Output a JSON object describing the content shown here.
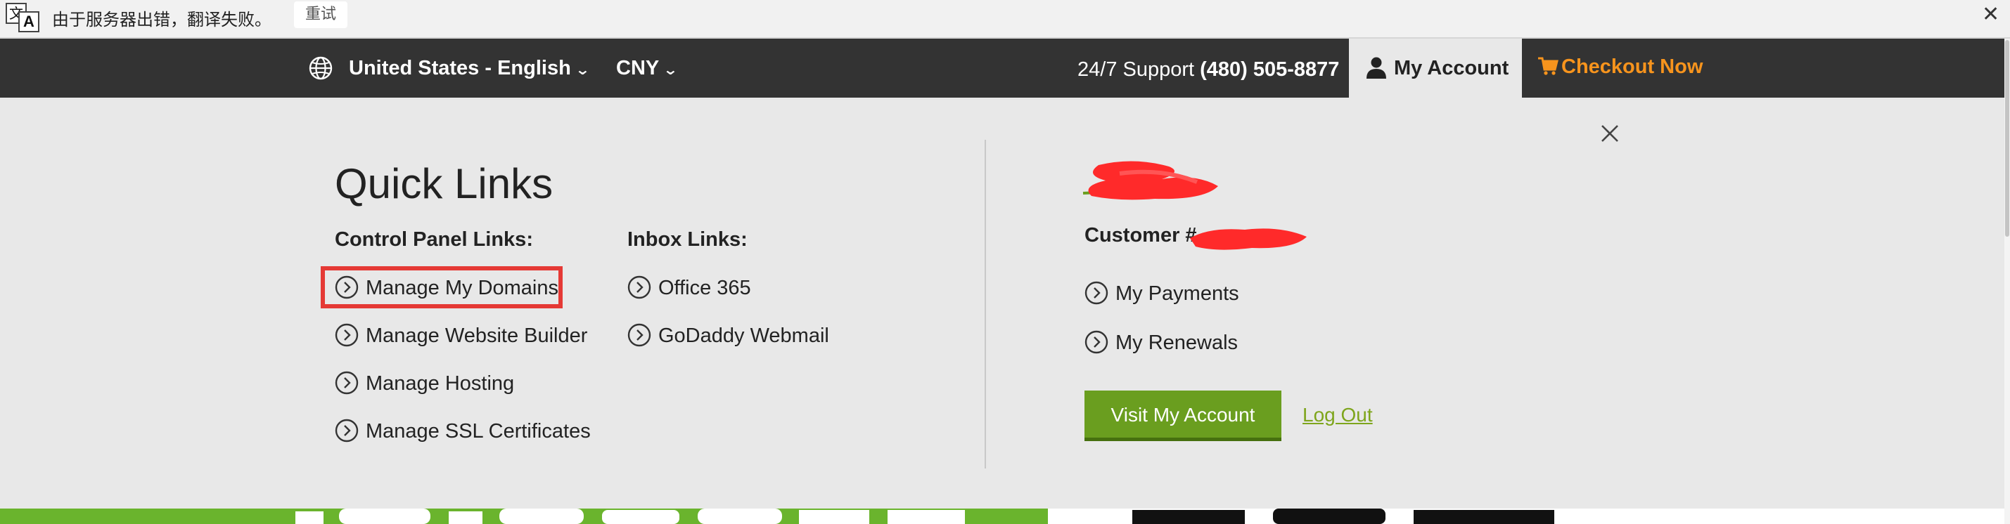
{
  "translate_bar": {
    "message": "由于服务器出错，翻译失败。",
    "retry_label": "重试",
    "close_glyph": "✕",
    "icon": "translate-icon"
  },
  "topnav": {
    "language": "United States - English",
    "currency": "CNY",
    "support_label": "24/7 Support",
    "support_phone": "(480) 505-8877",
    "account_label": "My Account",
    "checkout_label": "Checkout Now",
    "colors": {
      "bar": "#333333",
      "checkout": "#f7941d",
      "account_tab": "#e8e8e8"
    }
  },
  "panel": {
    "title": "Quick Links",
    "control_heading": "Control Panel Links:",
    "control_links": [
      {
        "label": "Manage My Domains"
      },
      {
        "label": "Manage Website Builder"
      },
      {
        "label": "Manage Hosting"
      },
      {
        "label": "Manage SSL Certificates"
      }
    ],
    "inbox_heading": "Inbox Links:",
    "inbox_links": [
      {
        "label": "Office 365"
      },
      {
        "label": "GoDaddy Webmail"
      }
    ],
    "customer_label": "Customer #",
    "account_links": [
      {
        "label": "My Payments"
      },
      {
        "label": "My Renewals"
      }
    ],
    "visit_button": "Visit My Account",
    "logout_label": "Log Out",
    "colors": {
      "button": "#6a9e1f",
      "highlight": "#e53935",
      "logout": "#7ea51c"
    }
  }
}
